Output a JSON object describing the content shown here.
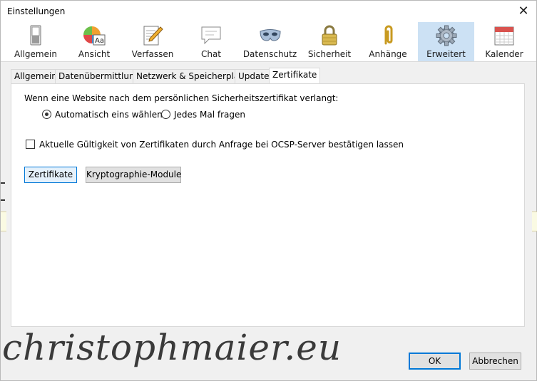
{
  "window": {
    "title": "Einstellungen",
    "close_glyph": "✕"
  },
  "toolbar": {
    "panes": [
      {
        "label": "Allgemein",
        "icon": "switch-icon"
      },
      {
        "label": "Ansicht",
        "icon": "color-palette-icon"
      },
      {
        "label": "Verfassen",
        "icon": "compose-pencil-icon"
      },
      {
        "label": "Chat",
        "icon": "speech-bubble-icon"
      },
      {
        "label": "Datenschutz",
        "icon": "mask-icon"
      },
      {
        "label": "Sicherheit",
        "icon": "padlock-icon"
      },
      {
        "label": "Anhänge",
        "icon": "paperclip-icon"
      },
      {
        "label": "Erweitert",
        "icon": "gear-icon"
      },
      {
        "label": "Kalender",
        "icon": "calendar-icon"
      }
    ],
    "selected": "Erweitert"
  },
  "tabs": [
    "Allgemein",
    "Datenübermittlung",
    "Netzwerk & Speicherplatz",
    "Update",
    "Zertifikate"
  ],
  "active_tab": "Zertifikate",
  "certificates": {
    "prompt": "Wenn eine Website nach dem persönlichen Sicherheitszertifikat verlangt:",
    "radio_auto": "Automatisch eins wählen",
    "radio_ask": "Jedes Mal fragen",
    "selected_option": "Automatisch eins wählen",
    "ocsp_label": "Aktuelle Gültigkeit von Zertifikaten durch Anfrage bei OCSP-Server bestätigen lassen",
    "ocsp_checked": false,
    "btn_certificates": "Zertifikate",
    "btn_crypto": "Kryptographie-Module"
  },
  "footer": {
    "ok": "OK",
    "cancel": "Abbrechen"
  },
  "watermark": "christophmaier.eu"
}
